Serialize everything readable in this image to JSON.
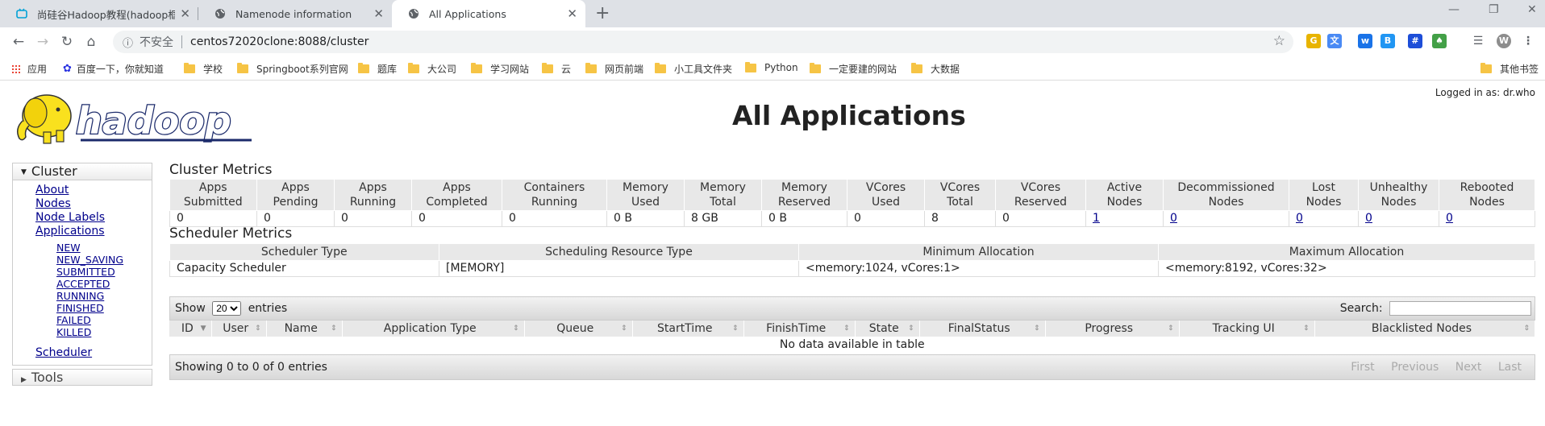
{
  "browser": {
    "tabs": [
      {
        "title": "尚硅谷Hadoop教程(hadoop框"
      },
      {
        "title": "Namenode information"
      },
      {
        "title": "All Applications"
      }
    ],
    "url": "centos72020clone:8088/cluster",
    "security_label": "不安全",
    "bookmarks": [
      "应用",
      "百度一下，你就知道",
      "学校",
      "Springboot系列官网",
      "题库",
      "大公司",
      "学习网站",
      "云",
      "网页前端",
      "小工具文件夹",
      "Python",
      "一定要建的网站",
      "大数据"
    ],
    "other_bookmarks": "其他书签",
    "profile_initial": "W"
  },
  "page": {
    "logged_in": "Logged in as: dr.who",
    "title": "All Applications",
    "logo_text": "hadoop"
  },
  "nav": {
    "cluster_label": "Cluster",
    "items": [
      "About",
      "Nodes",
      "Node Labels",
      "Applications"
    ],
    "app_states": [
      "NEW",
      "NEW_SAVING",
      "SUBMITTED",
      "ACCEPTED",
      "RUNNING",
      "FINISHED",
      "FAILED",
      "KILLED"
    ],
    "scheduler": "Scheduler",
    "tools_label": "Tools"
  },
  "cluster_metrics": {
    "title": "Cluster Metrics",
    "headers": [
      [
        "Apps",
        "Submitted"
      ],
      [
        "Apps",
        "Pending"
      ],
      [
        "Apps",
        "Running"
      ],
      [
        "Apps",
        "Completed"
      ],
      [
        "Containers",
        "Running"
      ],
      [
        "Memory",
        "Used"
      ],
      [
        "Memory",
        "Total"
      ],
      [
        "Memory",
        "Reserved"
      ],
      [
        "VCores",
        "Used"
      ],
      [
        "VCores",
        "Total"
      ],
      [
        "VCores",
        "Reserved"
      ],
      [
        "Active",
        "Nodes"
      ],
      [
        "Decommissioned",
        "Nodes"
      ],
      [
        "Lost",
        "Nodes"
      ],
      [
        "Unhealthy",
        "Nodes"
      ],
      [
        "Rebooted",
        "Nodes"
      ]
    ],
    "values": [
      "0",
      "0",
      "0",
      "0",
      "0",
      "0 B",
      "8 GB",
      "0 B",
      "0",
      "8",
      "0",
      "1",
      "0",
      "0",
      "0",
      "0"
    ]
  },
  "scheduler_metrics": {
    "title": "Scheduler Metrics",
    "headers": [
      "Scheduler Type",
      "Scheduling Resource Type",
      "Minimum Allocation",
      "Maximum Allocation"
    ],
    "values": [
      "Capacity Scheduler",
      "[MEMORY]",
      "<memory:1024, vCores:1>",
      "<memory:8192, vCores:32>"
    ]
  },
  "apps_table": {
    "show_label": "Show",
    "entries_value": "20",
    "entries_label": "entries",
    "search_label": "Search:",
    "columns": [
      "ID",
      "User",
      "Name",
      "Application Type",
      "Queue",
      "StartTime",
      "FinishTime",
      "State",
      "FinalStatus",
      "Progress",
      "Tracking UI",
      "Blacklisted Nodes"
    ],
    "empty_text": "No data available in table",
    "info_text": "Showing 0 to 0 of 0 entries",
    "pager": [
      "First",
      "Previous",
      "Next",
      "Last"
    ]
  }
}
